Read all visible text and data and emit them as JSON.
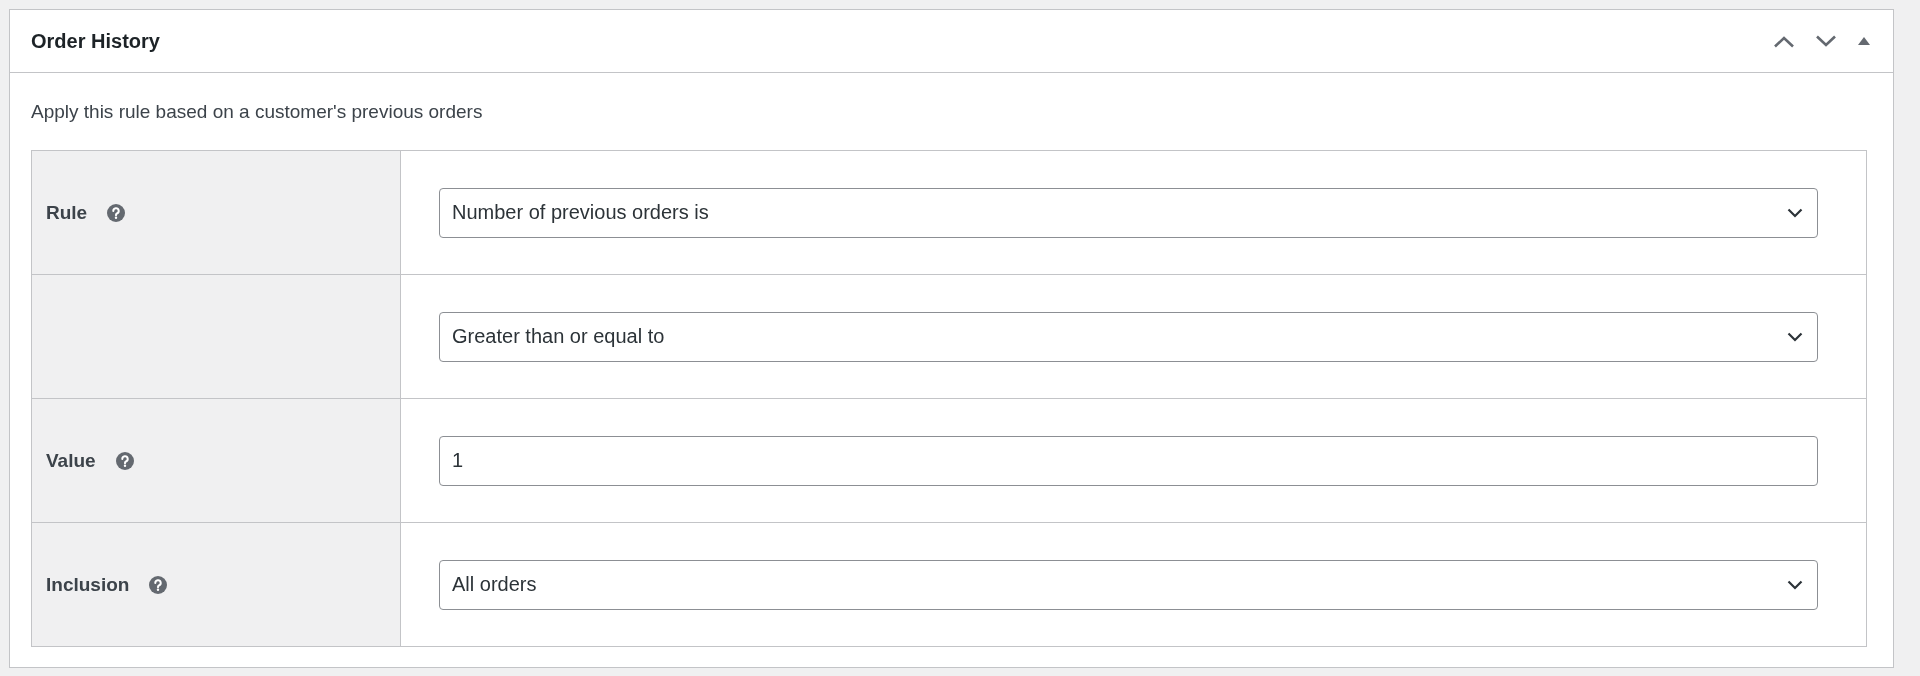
{
  "panel": {
    "title": "Order History",
    "description": "Apply this rule based on a customer's previous orders"
  },
  "rows": [
    {
      "label": "Rule",
      "help": true,
      "kind": "select",
      "value": "Number of previous orders is"
    },
    {
      "help": false,
      "kind": "select",
      "value": "Greater than or equal to"
    },
    {
      "label": "Value",
      "help": true,
      "kind": "text",
      "value": "1"
    },
    {
      "label": "Inclusion",
      "help": true,
      "kind": "select",
      "value": "All orders"
    }
  ]
}
